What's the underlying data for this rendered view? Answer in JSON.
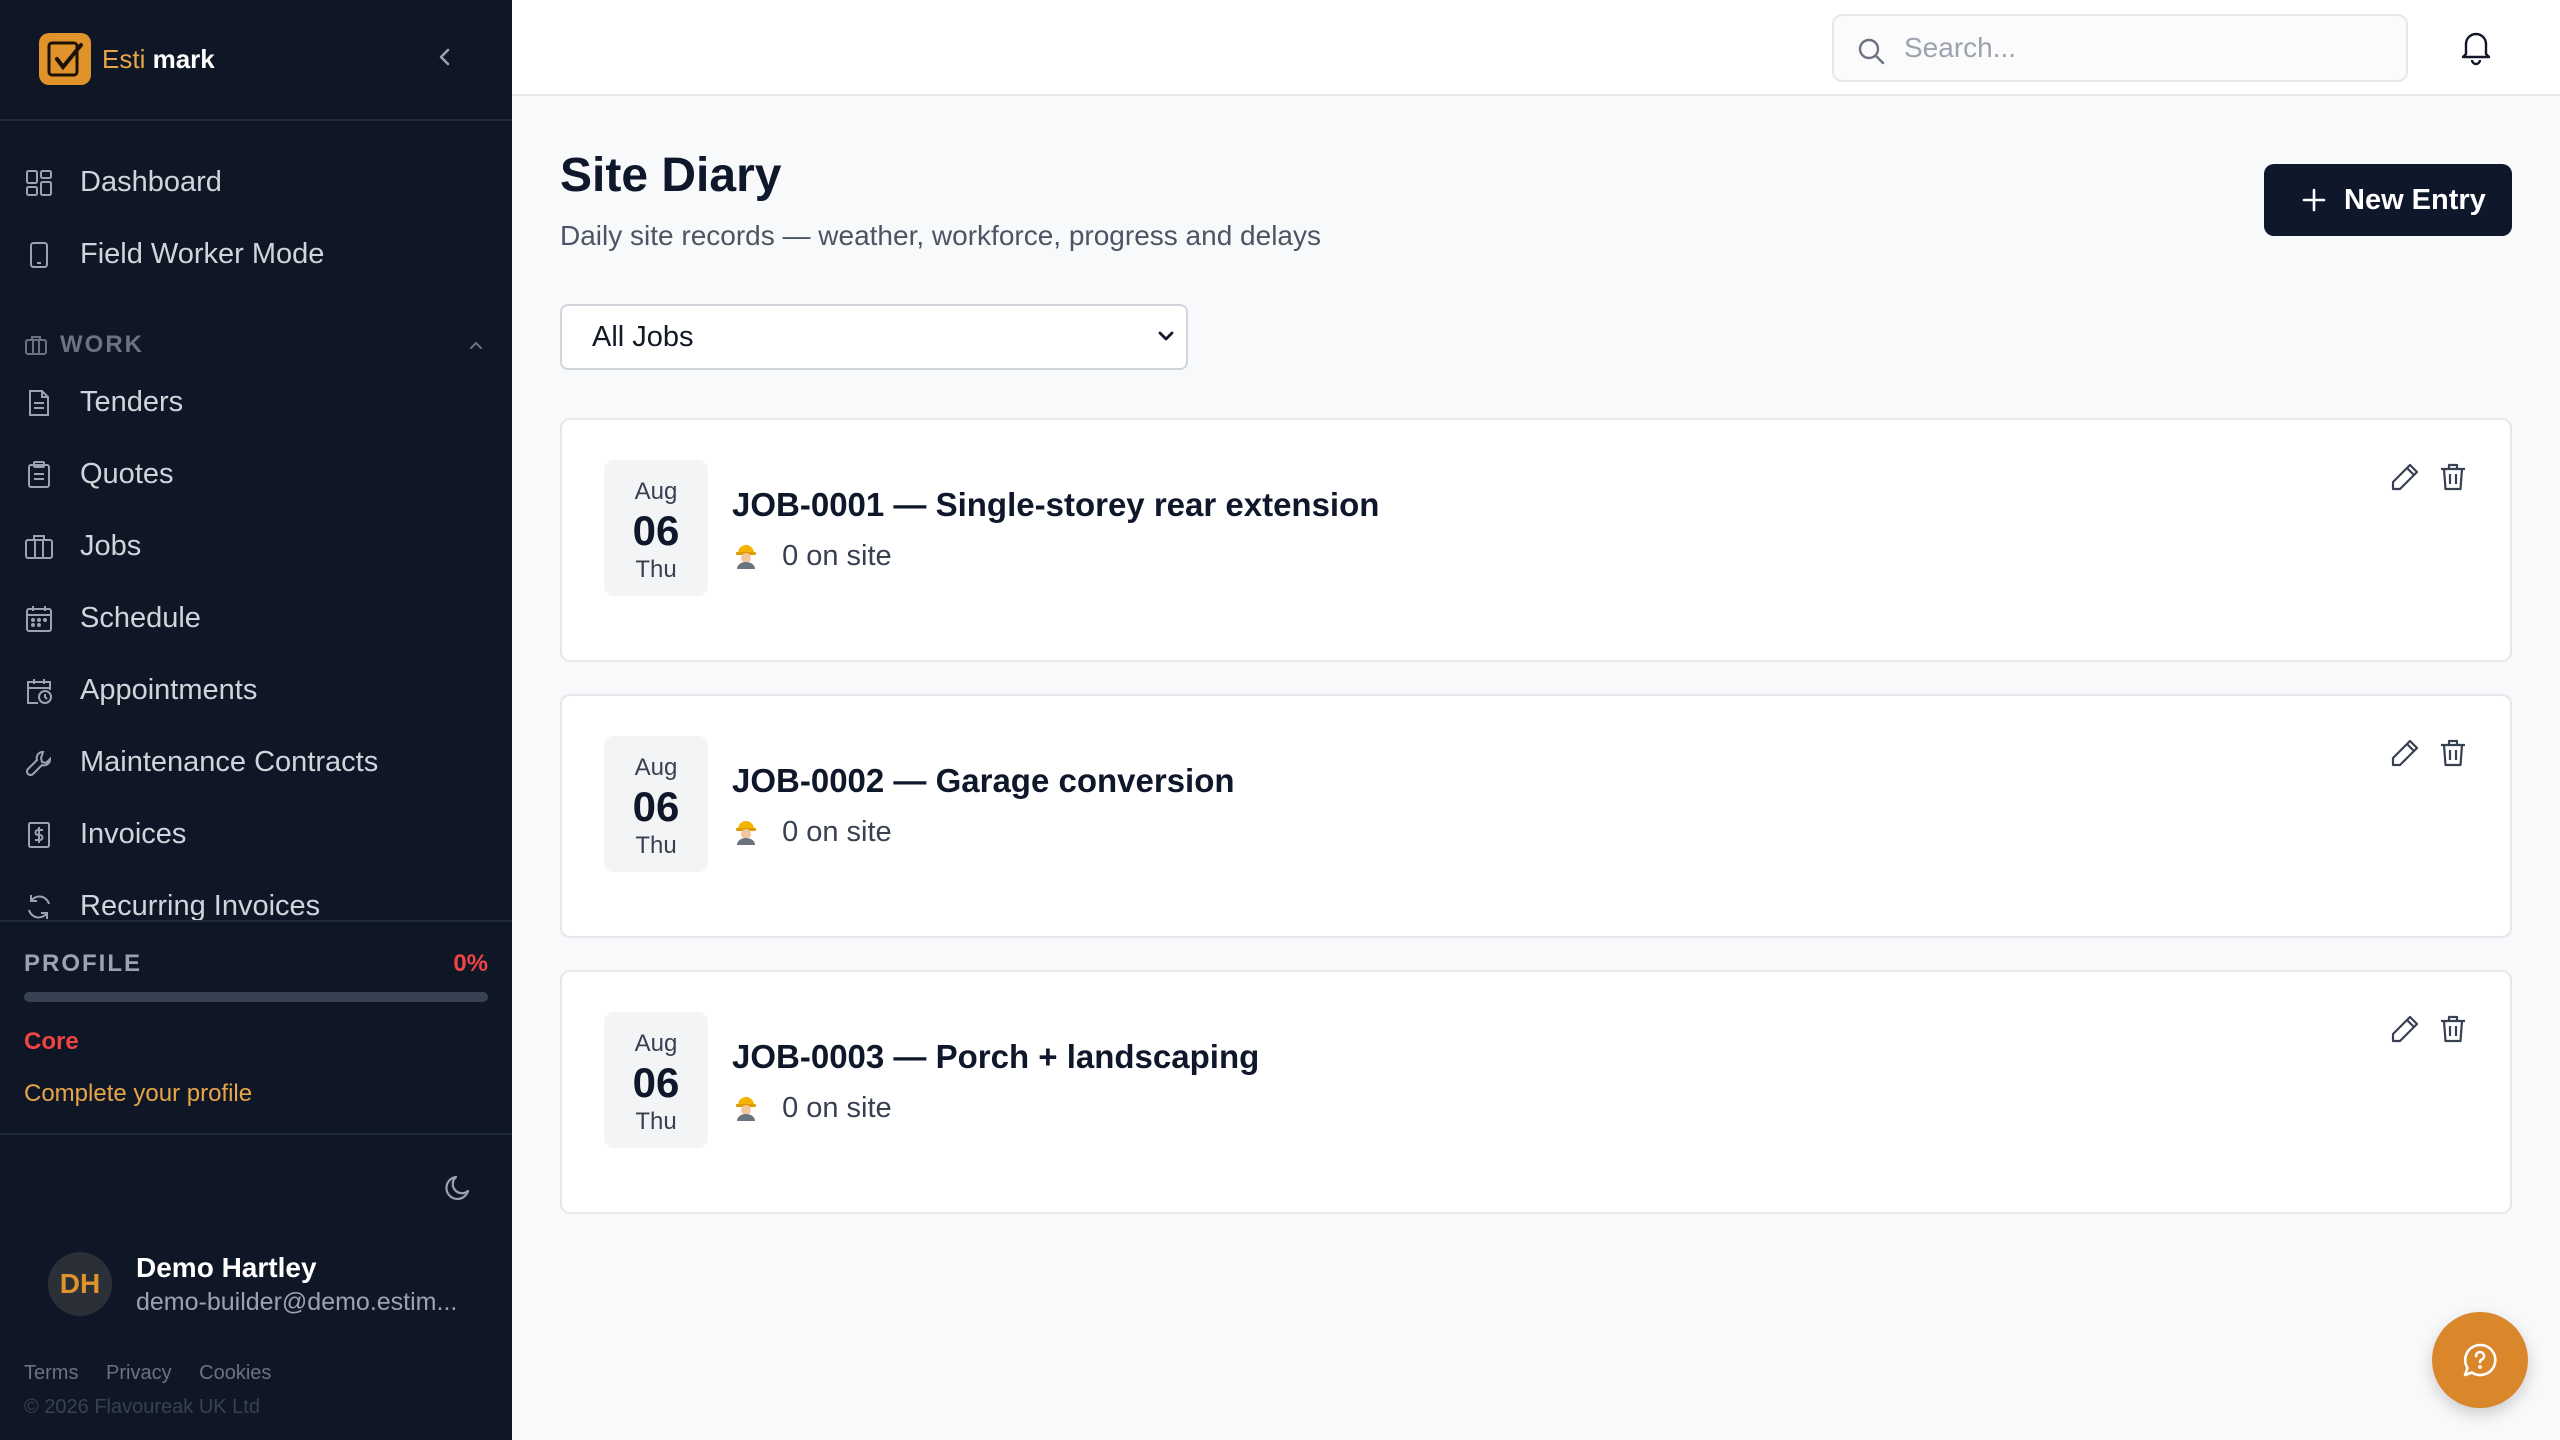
{
  "brand": {
    "name_part1": "Esti",
    "name_part2": "mark"
  },
  "sidebar": {
    "top_items": [
      {
        "label": "Dashboard",
        "icon": "dashboard-icon"
      },
      {
        "label": "Field Worker Mode",
        "icon": "phone-icon"
      }
    ],
    "section": {
      "label": "WORK",
      "icon": "briefcase-icon",
      "expanded": true
    },
    "work_items": [
      {
        "label": "Tenders",
        "icon": "document-icon"
      },
      {
        "label": "Quotes",
        "icon": "clipboard-icon"
      },
      {
        "label": "Jobs",
        "icon": "briefcase-icon"
      },
      {
        "label": "Schedule",
        "icon": "calendar-icon"
      },
      {
        "label": "Appointments",
        "icon": "calendar-clock-icon"
      },
      {
        "label": "Maintenance Contracts",
        "icon": "wrench-icon"
      },
      {
        "label": "Invoices",
        "icon": "invoice-icon"
      },
      {
        "label": "Recurring Invoices",
        "icon": "refresh-icon"
      }
    ],
    "profile": {
      "title": "PROFILE",
      "percent_label": "0%",
      "progress": 0,
      "tier": "Core",
      "cta": "Complete your profile"
    },
    "user": {
      "initials": "DH",
      "name": "Demo Hartley",
      "email": "demo-builder@demo.estim..."
    },
    "footer": {
      "links": [
        "Terms",
        "Privacy",
        "Cookies"
      ],
      "copyright": "© 2026 Flavoureak UK Ltd"
    }
  },
  "topbar": {
    "search_placeholder": "Search..."
  },
  "main": {
    "title": "Site Diary",
    "subtitle": "Daily site records — weather, workforce, progress and delays",
    "new_entry_label": "New Entry",
    "filter": {
      "selected": "All Jobs",
      "options": [
        "All Jobs"
      ]
    },
    "entries": [
      {
        "month": "Aug",
        "day": "06",
        "dow": "Thu",
        "title": "JOB-0001 — Single-storey rear extension",
        "on_site": "0 on site"
      },
      {
        "month": "Aug",
        "day": "06",
        "dow": "Thu",
        "title": "JOB-0002 — Garage conversion",
        "on_site": "0 on site"
      },
      {
        "month": "Aug",
        "day": "06",
        "dow": "Thu",
        "title": "JOB-0003 — Porch + landscaping",
        "on_site": "0 on site"
      }
    ]
  },
  "colors": {
    "sidebar_bg": "#0f1726",
    "accent": "#e0922b",
    "primary_button": "#0f172a",
    "danger": "#ef4444"
  }
}
